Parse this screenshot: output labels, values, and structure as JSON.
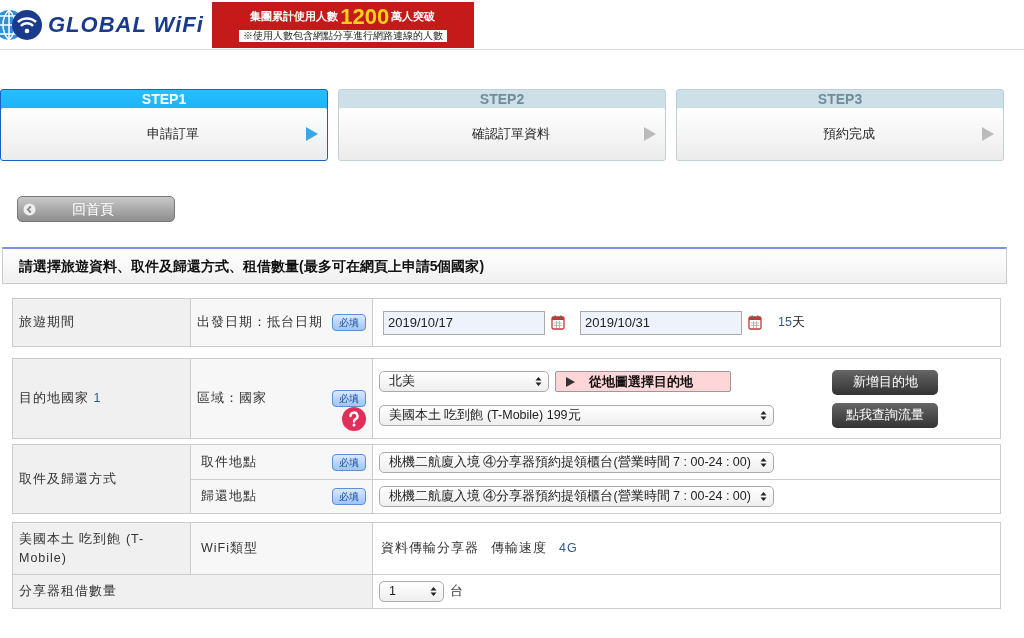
{
  "header": {
    "logo_text": "GLOBAL WiFi",
    "banner": {
      "text_before": "集團累計使用人數",
      "number": "1200",
      "text_after": "萬人突破",
      "note": "※使用人數包含網點分享進行網路連線的人數"
    }
  },
  "steps": [
    {
      "label": "STEP1",
      "title": "申請訂單",
      "selected": true
    },
    {
      "label": "STEP2",
      "title": "確認訂單資料",
      "selected": false
    },
    {
      "label": "STEP3",
      "title": "預約完成",
      "selected": false
    }
  ],
  "back_button": "回首頁",
  "section_title": "請選擇旅遊資料、取件及歸還方式、租借數量(最多可在網頁上申請5個國家)",
  "travel_period": {
    "label": "旅遊期間",
    "sublabel": "出發日期：抵台日期",
    "required": "必填",
    "start": "2019/10/17",
    "end": "2019/10/31",
    "days_number": "15",
    "days_unit": "天"
  },
  "destination": {
    "label": "目的地國家",
    "index": "1",
    "sublabel": "區域：國家",
    "required": "必填",
    "region": "北美",
    "map_button": "從地圖選擇目的地",
    "plan": "美國本土 吃到飽 (T-Mobile) 199元",
    "add_button": "新增目的地",
    "check_button": "點我查詢流量"
  },
  "pickup": {
    "label": "取件及歸還方式",
    "rows": [
      {
        "sublabel": "取件地點",
        "required": "必填",
        "value": "桃機二航廈入境 ④分享器預約提領櫃台(營業時間 7 : 00-24 : 00)"
      },
      {
        "sublabel": "歸還地點",
        "required": "必填",
        "value": "桃機二航廈入境 ④分享器預約提領櫃台(營業時間 7 : 00-24 : 00)"
      }
    ]
  },
  "wifi": {
    "plan_label": "美國本土 吃到飽 (T-Mobile)",
    "type_label": "WiFi類型",
    "device": "資料傳輸分享器",
    "speed_label": "傳輸速度",
    "speed": "4G"
  },
  "quantity": {
    "label": "分享器租借數量",
    "value": "1",
    "unit": "台"
  }
}
